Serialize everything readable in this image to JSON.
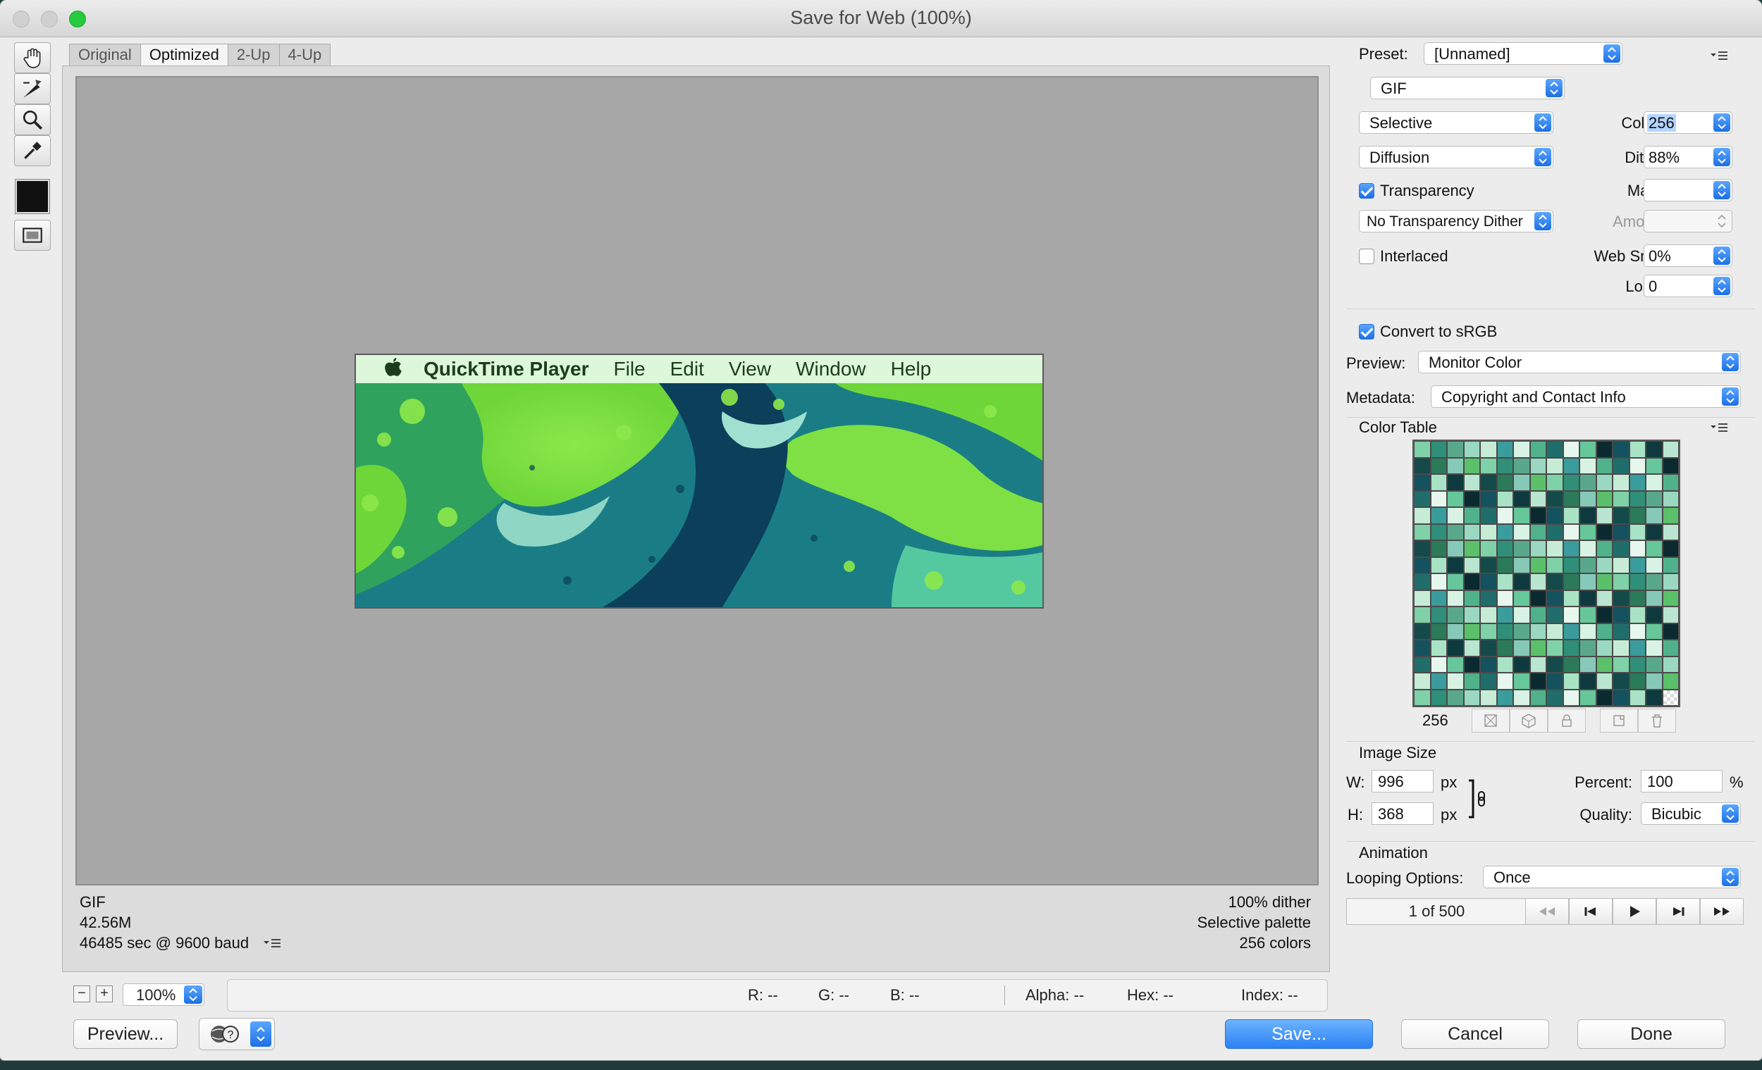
{
  "window": {
    "title": "Save for Web (100%)"
  },
  "colors": {
    "accent": "#1d70e6",
    "canvas": "#a7a7a7",
    "menubar": "#dcf7d9"
  },
  "tools": [
    "hand-tool-icon",
    "slice-select-tool-icon",
    "zoom-tool-icon",
    "eyedropper-tool-icon",
    "eyedropper-color-swatch",
    "toggle-slices-icon"
  ],
  "tabs": [
    {
      "label": "Original"
    },
    {
      "label": "Optimized"
    },
    {
      "label": "2-Up"
    },
    {
      "label": "4-Up"
    }
  ],
  "preview_image": {
    "menubar": {
      "app": "QuickTime Player",
      "items": [
        "File",
        "Edit",
        "View",
        "Window",
        "Help"
      ]
    }
  },
  "info_left": {
    "format": "GIF",
    "size": "42.56M",
    "time": "46485 sec @ 9600 baud"
  },
  "info_right": {
    "dither": "100% dither",
    "palette": "Selective palette",
    "colors": "256 colors"
  },
  "status": {
    "zoom": "100%",
    "r": "R: --",
    "g": "G: --",
    "b": "B: --",
    "alpha": "Alpha: --",
    "hex": "Hex: --",
    "index": "Index: --"
  },
  "buttons": {
    "preview": "Preview...",
    "save": "Save...",
    "cancel": "Cancel",
    "done": "Done"
  },
  "settings": {
    "preset_label": "Preset:",
    "preset": "[Unnamed]",
    "format": "GIF",
    "reduction": "Selective",
    "colors_label": "Colors:",
    "colors": "256",
    "dither_algo": "Diffusion",
    "dither_label": "Dither:",
    "dither": "88%",
    "transparency": "Transparency",
    "matte_label": "Matte:",
    "transparency_dither": "No Transparency Dither",
    "amount_label": "Amount:",
    "interlaced": "Interlaced",
    "websnap_label": "Web Snap:",
    "websnap": "0%",
    "lossy_label": "Lossy:",
    "lossy": "0",
    "srgb": "Convert to sRGB",
    "preview_label": "Preview:",
    "preview": "Monitor Color",
    "metadata_label": "Metadata:",
    "metadata": "Copyright and Contact Info"
  },
  "color_table": {
    "title": "Color Table",
    "count": "256"
  },
  "image_size": {
    "title": "Image Size",
    "w_label": "W:",
    "w": "996",
    "h_label": "H:",
    "h": "368",
    "unit": "px",
    "percent_label": "Percent:",
    "percent": "100",
    "percent_unit": "%",
    "quality_label": "Quality:",
    "quality": "Bicubic"
  },
  "animation": {
    "title": "Animation",
    "looping_label": "Looping Options:",
    "looping": "Once",
    "frame": "1 of 500"
  }
}
